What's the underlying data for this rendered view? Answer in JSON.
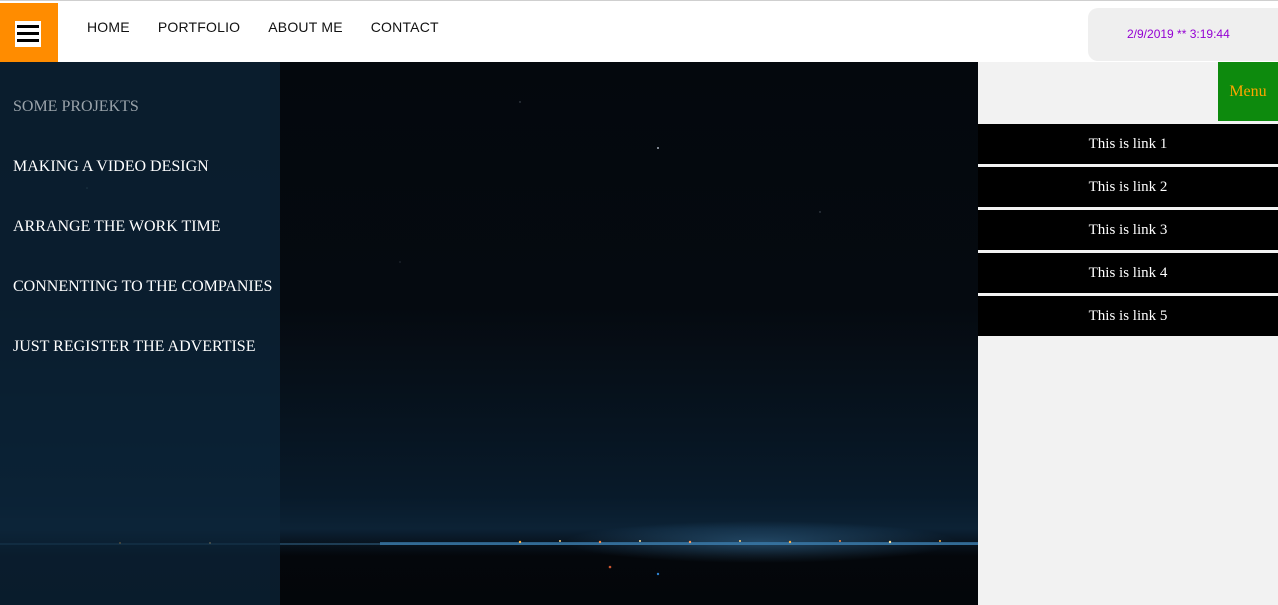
{
  "header": {
    "menu_icon": "hamburger-icon",
    "nav": [
      "HOME",
      "PORTFOLIO",
      "ABOUT ME",
      "CONTACT"
    ],
    "datetime": "2/9/2019 ** 3:19:44"
  },
  "projects": {
    "heading": "SOME PROJEKTS",
    "items": [
      "MAKING A VIDEO DESIGN",
      "ARRANGE THE WORK TIME",
      "CONNENTING TO THE COMPANIES",
      "JUST REGISTER THE ADVERTISE"
    ]
  },
  "side_menu": {
    "toggle_label": "Menu",
    "links": [
      "This is link 1",
      "This is link 2",
      "This is link 3",
      "This is link 4",
      "This is link 5"
    ]
  },
  "colors": {
    "hamburger_bg": "#ff8c00",
    "menu_toggle_bg": "#0d8a0d",
    "menu_toggle_text": "#ffa500",
    "datetime_text": "#9400d3"
  }
}
